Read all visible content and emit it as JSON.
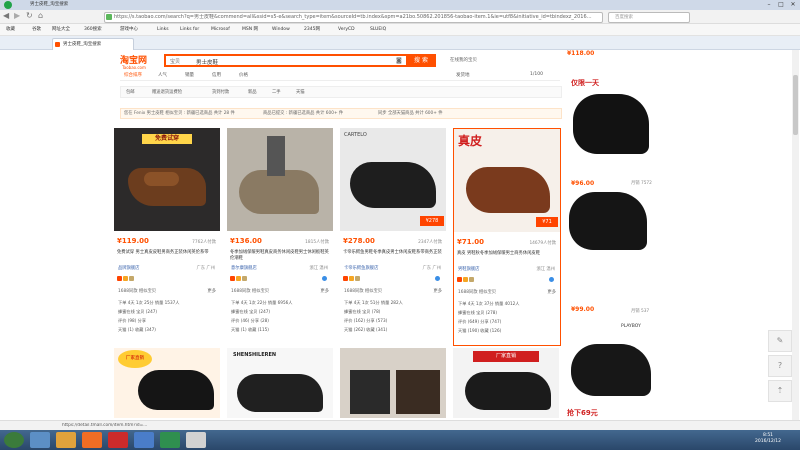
{
  "window": {
    "tab_title_prefix": "男士皮鞋_淘宝搜索",
    "url": "https://s.taobao.com/search?q=男士皮鞋&commend=all&ssid=s5-e&search_type=item&sourceId=tb.index&spm=a21bo.50862.201856-taobao-item.1&ie=utf8&initiative_id=tbindexz_20161212",
    "search_placeholder": "百度搜索"
  },
  "bookmarks": [
    "收藏",
    "谷歌",
    "网址大全",
    "360搜索",
    "游戏中心",
    "Links",
    "Links for",
    "Microsof",
    "MSN 网",
    "Window",
    "2345网",
    "VeryCD",
    "SLUEIQ"
  ],
  "tabs": [
    {
      "label": "男士皮鞋_淘宝搜索",
      "active": true
    }
  ],
  "taobao": {
    "logo": "淘宝网",
    "logo_sub": "Taobao.com",
    "search_scope": "宝贝",
    "search_keyword": "男士皮鞋",
    "search_button": "搜 索",
    "history": "在线我的宝贝",
    "filter_tabs": [
      "综合排序",
      "人气",
      "销量",
      "信用",
      "价格"
    ],
    "filter_right": [
      "发货地",
      "1/100"
    ],
    "sub_filters": [
      "包邮",
      "赠送退货运费险",
      "货到付款",
      "新品",
      "二手",
      "天猫"
    ],
    "tips": [
      "您在 Fenix 男士皮鞋 相似宝贝 : 新疆已选商品 共计 28 件",
      "商品已提交 : 新疆已选商品 共计 600+ 件",
      "同步 全部天猫商品 共计 600+ 件"
    ]
  },
  "products": [
    {
      "price": "¥119.00",
      "sales": "7762人付款",
      "title": "免费试穿 男士真皮皮鞋男商务正装休闲英伦系带",
      "shop": "品牌旗舰店",
      "loc": "广东 广州",
      "similar": "1688同款 相似宝贝",
      "more": "更多",
      "lines": [
        "下单 4天 1次 25分 销量 1537人",
        "蜂蜜在线 宝贝 (247)",
        "评价 (98) 分享",
        "天猫 (1) 收藏 (347)"
      ]
    },
    {
      "price": "¥136.00",
      "sales": "1815人付款",
      "title": "冬季加绒保暖男鞋真皮商务休闲皮鞋男士休闲板鞋英伦潮鞋",
      "shop": "意尔康旗舰店",
      "loc": "浙江 温州",
      "similar": "1688同款 相似宝贝",
      "more": "更多",
      "lines": [
        "下单 4天 1次 22分 销量 6956人",
        "蜂蜜在线 宝贝 (247)",
        "评价 (46) 分享 (28)",
        "天猫 (1) 收藏 (115)"
      ]
    },
    {
      "price": "¥278.00",
      "sales": "2347人付款",
      "title": "卡帝乐鳄鱼男鞋冬季真皮男士休闲皮鞋系带商务正装",
      "shop": "卡帝乐鳄鱼旗舰店",
      "loc": "广东 广州",
      "similar": "1688同款 相似宝贝",
      "more": "更多",
      "lines": [
        "下单 4天 1次 51分 销量 282人",
        "蜂蜜在线 宝贝 (78)",
        "评价 (162) 分享 (573)",
        "天猫 (262) 收藏 (341)"
      ]
    },
    {
      "price": "¥71.00",
      "sales": "14679人付款",
      "title": "真皮 男鞋秋冬季加绒保暖男士商务休闲皮鞋",
      "shop": "男鞋旗舰店",
      "loc": "浙江 温州",
      "similar": "1688同款 相似宝贝",
      "more": "更多",
      "lines": [
        "下单 4天 1次 37分 销量 4012人",
        "蜂蜜在线 宝贝 (278)",
        "评价 (649) 分享 (747)",
        "天猫 (190) 收藏 (126)"
      ]
    }
  ],
  "ads": [
    {
      "price": "¥118.00",
      "sales": "",
      "tag": "仅限一天"
    },
    {
      "price": "¥96.00",
      "sales": "月销 7572",
      "tag": ""
    },
    {
      "price": "¥99.00",
      "sales": "月销 537",
      "tag": ""
    },
    {
      "price": "",
      "sales": "",
      "tag": "抢下69元"
    }
  ],
  "statusbar": {
    "url": "https://detail.tmall.com/item.htm?id=..."
  },
  "taskbar": {
    "time": "8:51",
    "date": "2016/12/12"
  }
}
